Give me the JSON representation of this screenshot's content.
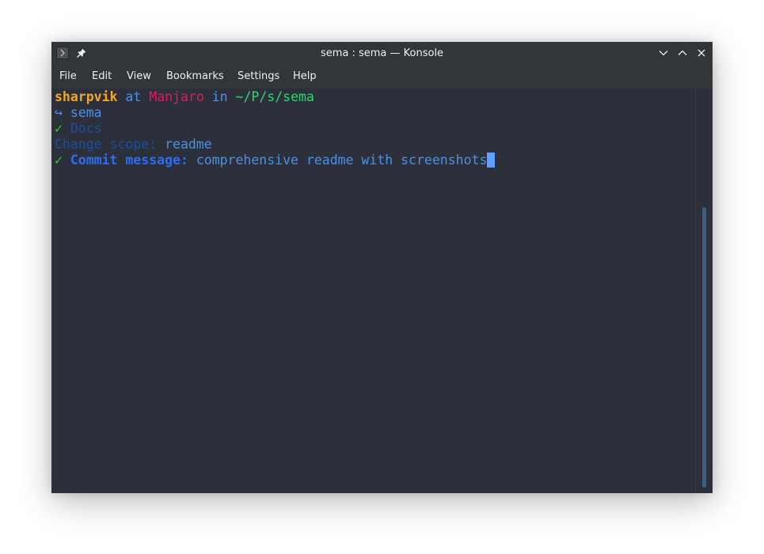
{
  "window": {
    "title": "sema : sema — Konsole"
  },
  "icons": {
    "app": "terminal-icon",
    "pin": "pin-icon",
    "minimize": "chevron-down-icon",
    "maximize": "chevron-up-icon",
    "close": "close-icon"
  },
  "menu": {
    "items": [
      "File",
      "Edit",
      "View",
      "Bookmarks",
      "Settings",
      "Help"
    ]
  },
  "terminal": {
    "prompt": {
      "user": "sharpvik",
      "at": " at ",
      "host": "Manjaro",
      "in": " in ",
      "path": "~/P/s/sema"
    },
    "lines": [
      {
        "symbol": "↪",
        "text": " sema"
      },
      {
        "symbol": "✓",
        "text": " Docs"
      },
      {
        "label": "Change scope:",
        "value": " readme"
      },
      {
        "symbol": "✓",
        "label": " Commit message:",
        "value": " comprehensive readme with screenshots"
      }
    ]
  },
  "colors": {
    "background": "#2b303b",
    "user": "#f5a623",
    "host": "#e8165f",
    "path": "#2bd96b",
    "blue": "#4d8fe6",
    "dim_blue": "#1f4e9c",
    "bright_blue": "#2f6df0",
    "check": "#2bdc1c",
    "cursor": "#5f9fff"
  }
}
